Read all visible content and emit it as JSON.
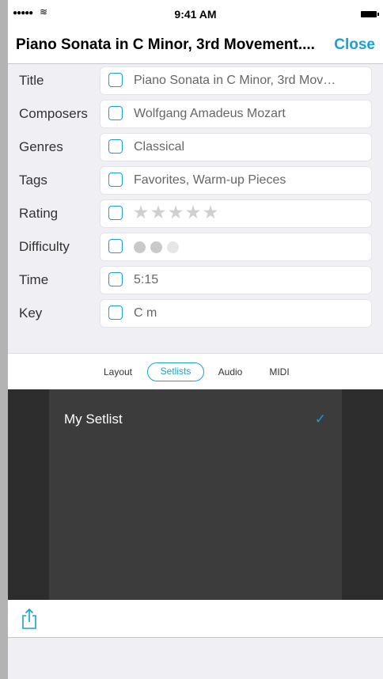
{
  "status_bar": {
    "signal": "●●●●●",
    "wifi": "≋",
    "time": "9:41 AM"
  },
  "nav": {
    "title": "Piano Sonata in C Minor, 3rd Movement....",
    "close_label": "Close"
  },
  "fields": [
    {
      "label": "Title",
      "value": "Piano Sonata in C Minor, 3rd Mov…"
    },
    {
      "label": "Composers",
      "value": "Wolfgang Amadeus Mozart"
    },
    {
      "label": "Genres",
      "value": "Classical"
    },
    {
      "label": "Tags",
      "value": "Favorites, Warm-up Pieces"
    },
    {
      "label": "Rating",
      "value": "",
      "stars": 5,
      "rating": 0
    },
    {
      "label": "Difficulty",
      "value": "",
      "difficulty_max": 3,
      "difficulty": 2
    },
    {
      "label": "Time",
      "value": "5:15"
    },
    {
      "label": "Key",
      "value": "C m"
    }
  ],
  "tabs": [
    {
      "label": "Layout",
      "active": false
    },
    {
      "label": "Setlists",
      "active": true
    },
    {
      "label": "Audio",
      "active": false
    },
    {
      "label": "MIDI",
      "active": false
    }
  ],
  "setlists": [
    {
      "name": "My Setlist",
      "checked": true
    }
  ],
  "icons": {
    "checkmark": "✓",
    "star": "★",
    "share": "share-icon"
  },
  "colors": {
    "accent": "#1a9fd8",
    "panel_dark": "#2d2d2d",
    "panel_mid": "#3c3c3c"
  }
}
